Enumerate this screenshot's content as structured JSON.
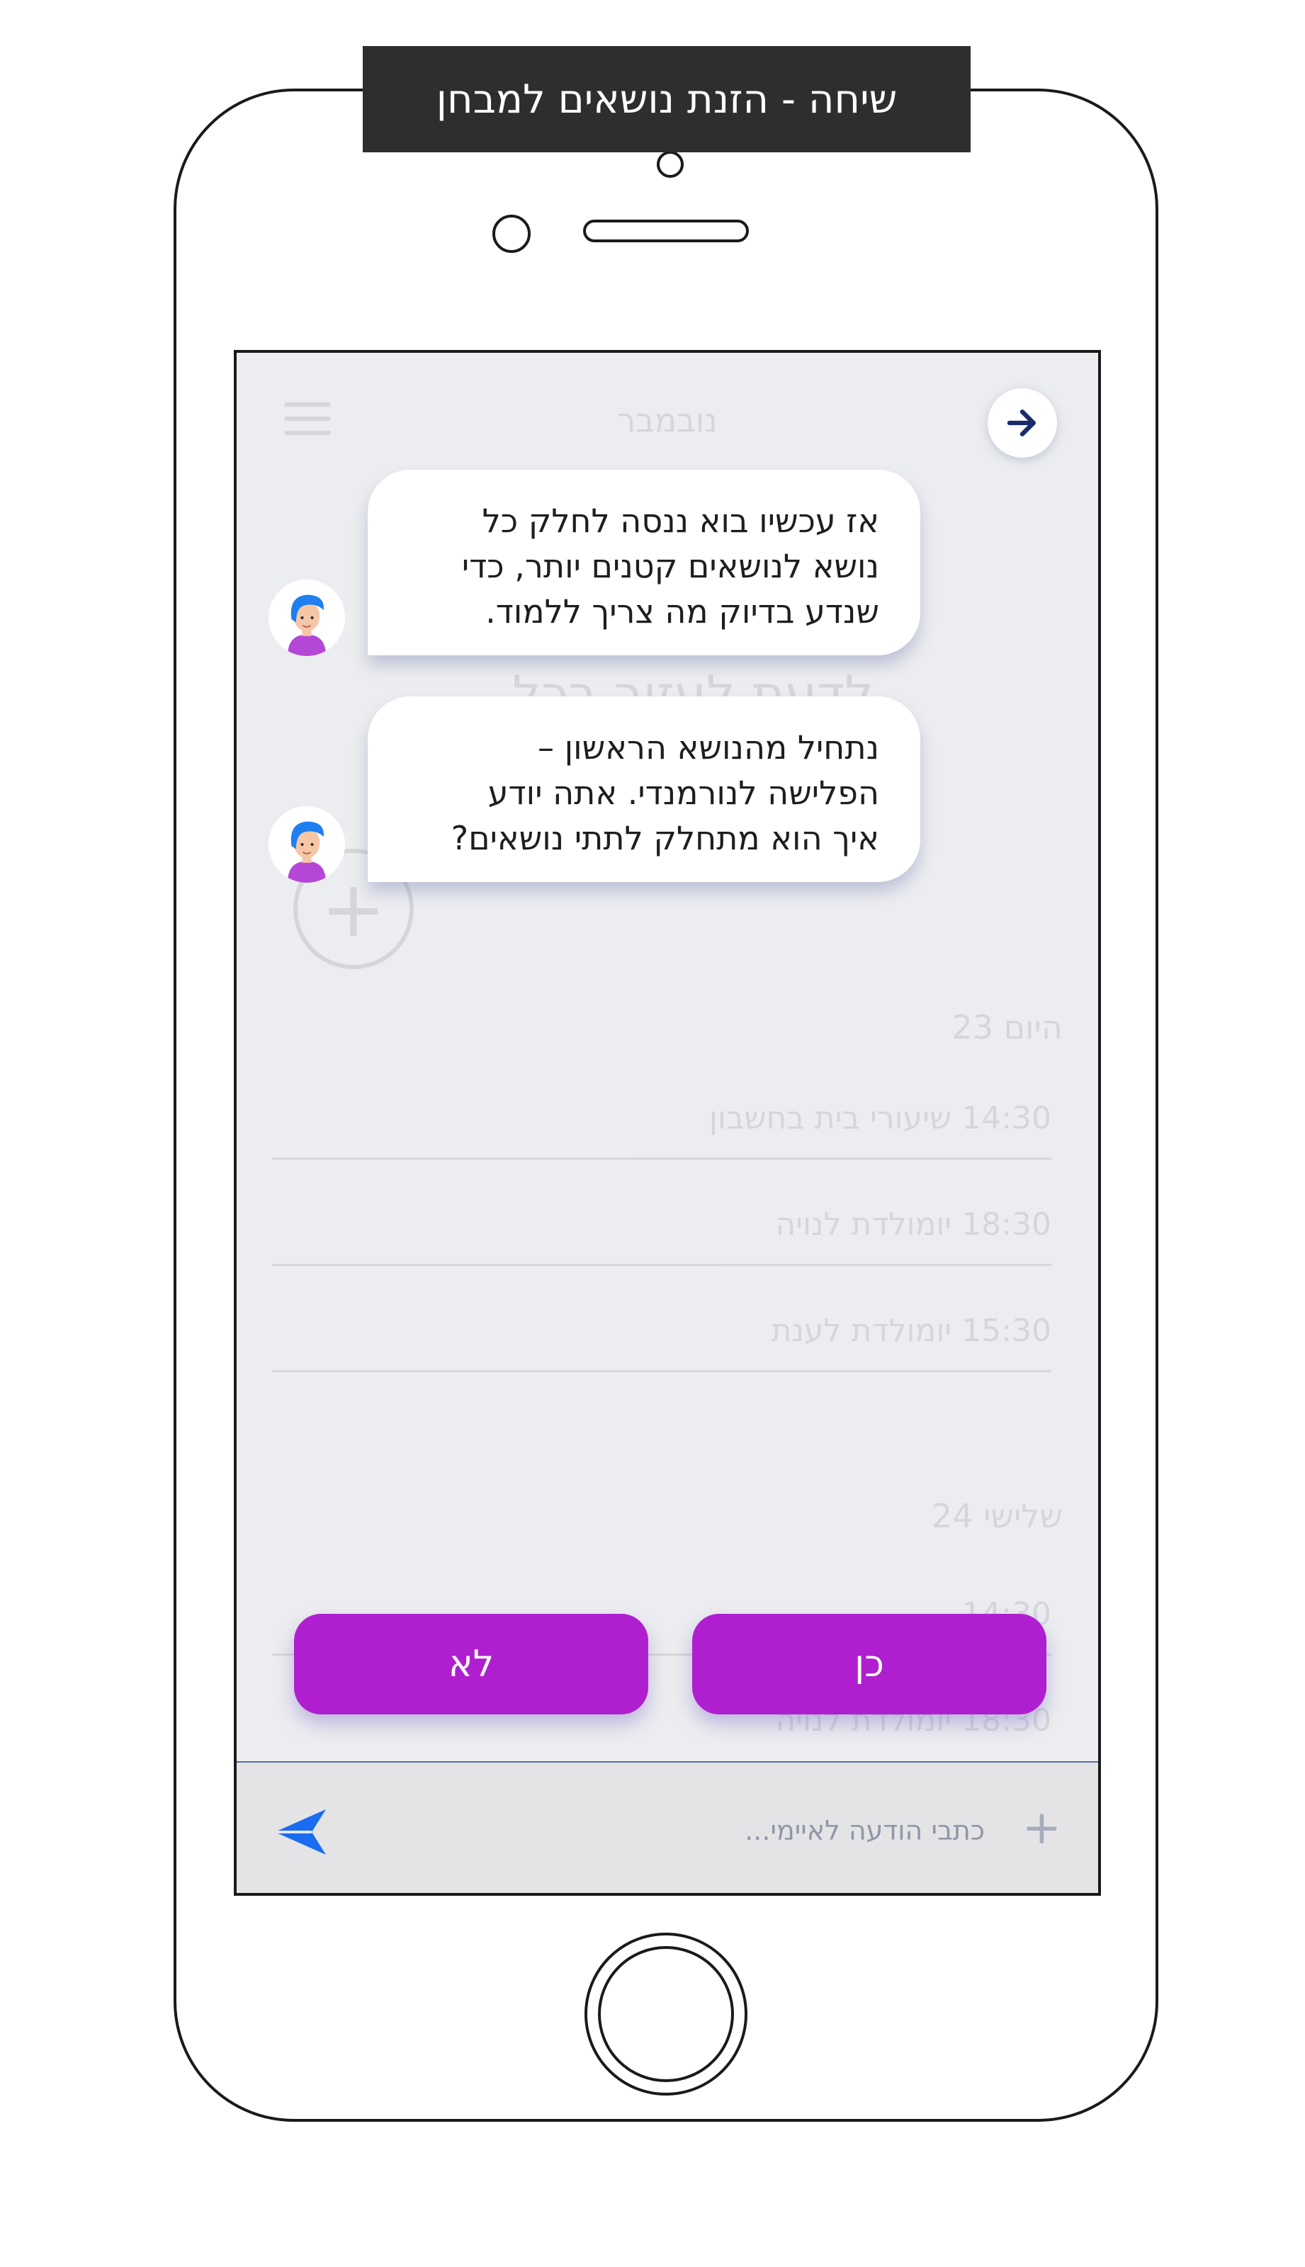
{
  "header": {
    "title": "שיחה - הזנת נושאים למבחן"
  },
  "background": {
    "month": "נובמבר",
    "heading": "לדעת לעזור בכל...",
    "days": [
      {
        "label": "היום 23",
        "events": [
          "14:30 שיעורי בית בחשבון",
          "18:30 יומולדת לנויה",
          "15:30 יומולדת לענת"
        ]
      },
      {
        "label": "שלישי 24",
        "events": [
          "14:30",
          "18:30 יומולדת לנויה"
        ]
      }
    ]
  },
  "chat": {
    "messages": [
      {
        "sender": "bot",
        "text": "אז עכשיו בוא ננסה לחלק כל\nנושא לנושאים קטנים יותר, כדי\nשנדע בדיוק מה צריך ללמוד."
      },
      {
        "sender": "bot",
        "text": "נתחיל מהנושא הראשון –\nהפלישה לנורמנדי. אתה יודע\nאיך הוא מתחלק לתתי נושאים?"
      }
    ]
  },
  "choices": {
    "yes": "כן",
    "no": "לא"
  },
  "composer": {
    "placeholder": "כתבי הודעה לאיימי..."
  },
  "colors": {
    "accent": "#b01fcf",
    "send": "#1a6cf0",
    "back_arrow": "#1b2a6b"
  },
  "icons": {
    "back": "arrow-right-icon",
    "send": "send-icon",
    "attach": "plus-icon",
    "avatar": "bot-avatar"
  }
}
